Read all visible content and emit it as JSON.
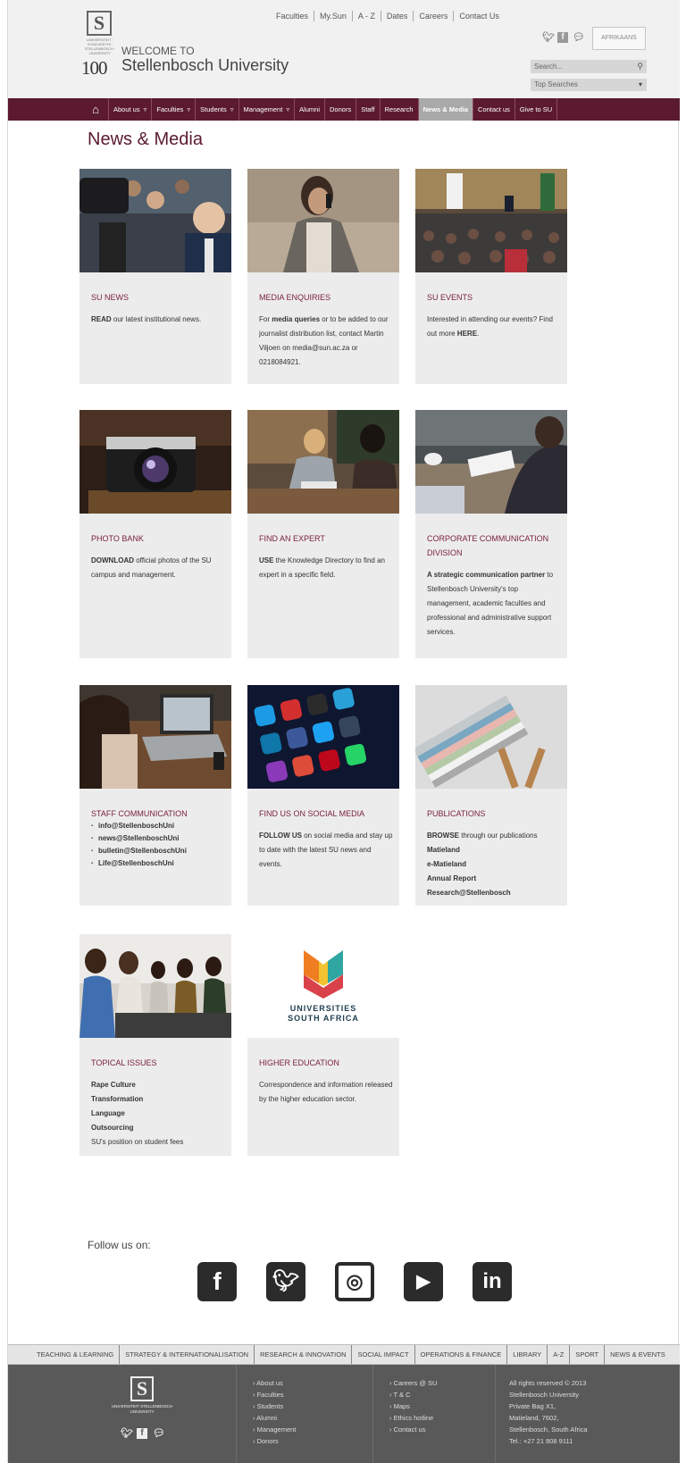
{
  "header": {
    "crest_letter": "S",
    "crest_tagline": "UNIVERSITEIT · iYUNIVESITHI · STELLENBOSCH · UNIVERSITY",
    "welcome": "WELCOME TO",
    "centenary": "100",
    "university_name": "Stellenbosch University",
    "top_links": [
      "Faculties",
      "My.Sun",
      "A - Z",
      "Dates",
      "Careers",
      "Contact Us"
    ],
    "social_icons": [
      "twitter-icon",
      "facebook-icon",
      "chat-icon"
    ],
    "language_button": "AFRIKAANS",
    "search_placeholder": "Search...",
    "top_searches_label": "Top Searches"
  },
  "nav": {
    "items": [
      {
        "label": "About us",
        "has_dropdown": true
      },
      {
        "label": "Faculties",
        "has_dropdown": true
      },
      {
        "label": "Students",
        "has_dropdown": true
      },
      {
        "label": "Management",
        "has_dropdown": true
      },
      {
        "label": "Alumni",
        "has_dropdown": false
      },
      {
        "label": "Donors",
        "has_dropdown": false
      },
      {
        "label": "Staff",
        "has_dropdown": false
      },
      {
        "label": "Research",
        "has_dropdown": false
      },
      {
        "label": "News & Media",
        "has_dropdown": false,
        "active": true
      },
      {
        "label": "Contact us",
        "has_dropdown": false
      },
      {
        "label": "Give to SU",
        "has_dropdown": false
      }
    ],
    "dropdown_glyph": "▿"
  },
  "page_title": "News & Media",
  "cards": {
    "su_news": {
      "title": "SU NEWS",
      "bold": "READ",
      "text": " our latest institutional news."
    },
    "media_enquiries": {
      "title": "MEDIA ENQUIRIES",
      "pre": "For ",
      "bold": "media queries",
      "text": " or to be added to our journalist distribution list, contact Martin Viljoen on media@sun.ac.za or 0218084921."
    },
    "su_events": {
      "title": "SU EVENTS",
      "pre": "Interested in attending our events? Find out more ",
      "bold": "HERE",
      "post": "."
    },
    "photo_bank": {
      "title": "PHOTO BANK",
      "bold": "DOWNLOAD",
      "text": " official photos of the SU campus and management."
    },
    "find_expert": {
      "title": "FIND AN EXPERT",
      "bold": "USE",
      "text": " the Knowledge Directory to find an expert in a specific field."
    },
    "corporate": {
      "title": "CORPORATE COMMUNICATION DIVISION",
      "bold": "A strategic communication partner",
      "text": " to Stellenbosch University's top management, academic faculties and professional and administrative support services."
    },
    "staff_comm": {
      "title": "STAFF COMMUNICATION",
      "items": [
        "info@StellenboschUni",
        "news@StellenboschUni",
        "bulletin@StellenboschUni",
        "Life@StellenboschUni"
      ]
    },
    "social_media": {
      "title": "FIND US ON SOCIAL MEDIA",
      "bold": "FOLLOW US",
      "text": " on social media and stay up to date with the latest SU news and events."
    },
    "publications": {
      "title": "PUBLICATIONS",
      "bold": "BROWSE",
      "text": " through our publications",
      "items": [
        "Matieland",
        "e-Matieland",
        "Annual Report",
        "Research@Stellenbosch"
      ]
    },
    "topical": {
      "title": "TOPICAL ISSUES",
      "items": [
        "Rape Culture",
        "Transformation",
        "Language",
        "Outsourcing"
      ],
      "note": "SU's position on student fees"
    },
    "higher_ed": {
      "title": "HIGHER EDUCATION",
      "text": "Correspondence and information released by the higher education sector.",
      "logo_line1": "UNIVERSITIES",
      "logo_line2": "SOUTH AFRICA"
    }
  },
  "follow": {
    "label": "Follow us on:",
    "icons": [
      "facebook-icon",
      "twitter-icon",
      "instagram-icon",
      "youtube-icon",
      "linkedin-icon"
    ]
  },
  "footer": {
    "bar_links": [
      "TEACHING & LEARNING",
      "STRATEGY & INTERNATIONALISATION",
      "RESEARCH & INNOVATION",
      "SOCIAL IMPACT",
      "OPERATIONS & FINANCE",
      "LIBRARY",
      "A-Z",
      "SPORT",
      "NEWS & EVENTS"
    ],
    "logo_text": "UNIVERSITEIT STELLENBOSCH UNIVERSITY",
    "col1": [
      "About us",
      "Faculties",
      "Students",
      "Alumni",
      "Management",
      "Donors"
    ],
    "col2": [
      "Careers @ SU",
      "T & C",
      "Maps",
      "Ethics hotline",
      "Contact us"
    ],
    "address": [
      "All rights reserved © 2013",
      "Stellenbosch University",
      "Private Bag X1,",
      "Matieland, 7602,",
      "Stellenbosch, South Africa",
      "Tel.: +27 21 808 9111"
    ]
  },
  "colors": {
    "brand_maroon": "#5b1a30",
    "card_title": "#7a1f3d",
    "card_bg": "#ececec",
    "footer_bg": "#595959"
  }
}
